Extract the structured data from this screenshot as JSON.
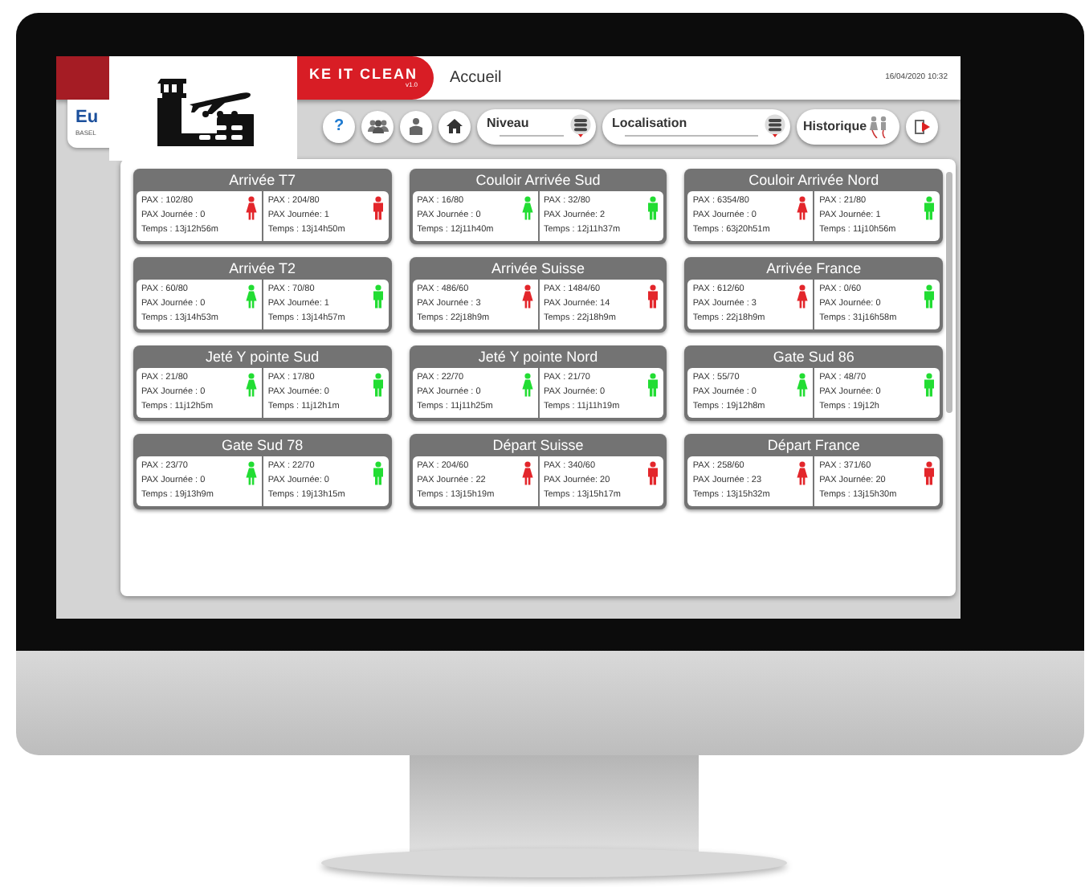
{
  "header": {
    "brand_text": "KE IT CLEAN",
    "version": "v1.0",
    "title": "Accueil",
    "datetime": "16/04/2020 10:32",
    "org_text": "Eu",
    "org_subtext": "BASEL"
  },
  "toolbar": {
    "dropdowns": [
      {
        "label": "Niveau"
      },
      {
        "label": "Localisation"
      }
    ],
    "history_label": "Historique",
    "help_label": "?"
  },
  "zones": [
    {
      "name": "Arrivée T7",
      "slots": [
        {
          "kind": "women",
          "color": "#e3262b",
          "pax": "PAX : 102/80",
          "pax_day": "PAX Journée : 0",
          "time": "Temps : 13j12h56m"
        },
        {
          "kind": "men",
          "color": "#e3262b",
          "pax": "PAX : 204/80",
          "pax_day": "PAX Journée: 1",
          "time": "Temps : 13j14h50m"
        }
      ]
    },
    {
      "name": "Couloir Arrivée Sud",
      "slots": [
        {
          "kind": "women",
          "color": "#22dd33",
          "pax": "PAX : 16/80",
          "pax_day": "PAX Journée : 0",
          "time": "Temps : 12j11h40m"
        },
        {
          "kind": "men",
          "color": "#22dd33",
          "pax": "PAX : 32/80",
          "pax_day": "PAX Journée: 2",
          "time": "Temps : 12j11h37m"
        }
      ]
    },
    {
      "name": "Couloir Arrivée Nord",
      "slots": [
        {
          "kind": "women",
          "color": "#e3262b",
          "pax": "PAX : 6354/80",
          "pax_day": "PAX Journée : 0",
          "time": "Temps : 63j20h51m"
        },
        {
          "kind": "men",
          "color": "#22dd33",
          "pax": "PAX : 21/80",
          "pax_day": "PAX Journée: 1",
          "time": "Temps : 11j10h56m"
        }
      ]
    },
    {
      "name": "Arrivée T2",
      "slots": [
        {
          "kind": "women",
          "color": "#22dd33",
          "pax": "PAX : 60/80",
          "pax_day": "PAX Journée : 0",
          "time": "Temps : 13j14h53m"
        },
        {
          "kind": "men",
          "color": "#22dd33",
          "pax": "PAX : 70/80",
          "pax_day": "PAX Journée: 1",
          "time": "Temps : 13j14h57m"
        }
      ]
    },
    {
      "name": "Arrivée Suisse",
      "slots": [
        {
          "kind": "women",
          "color": "#e3262b",
          "pax": "PAX : 486/60",
          "pax_day": "PAX Journée : 3",
          "time": "Temps : 22j18h9m"
        },
        {
          "kind": "men",
          "color": "#e3262b",
          "pax": "PAX : 1484/60",
          "pax_day": "PAX Journée: 14",
          "time": "Temps : 22j18h9m"
        }
      ]
    },
    {
      "name": "Arrivée France",
      "slots": [
        {
          "kind": "women",
          "color": "#e3262b",
          "pax": "PAX : 612/60",
          "pax_day": "PAX Journée : 3",
          "time": "Temps : 22j18h9m"
        },
        {
          "kind": "men",
          "color": "#22dd33",
          "pax": "PAX : 0/60",
          "pax_day": "PAX Journée: 0",
          "time": "Temps : 31j16h58m"
        }
      ]
    },
    {
      "name": "Jeté Y pointe Sud",
      "slots": [
        {
          "kind": "women",
          "color": "#22dd33",
          "pax": "PAX : 21/80",
          "pax_day": "PAX Journée : 0",
          "time": "Temps : 11j12h5m"
        },
        {
          "kind": "men",
          "color": "#22dd33",
          "pax": "PAX : 17/80",
          "pax_day": "PAX Journée: 0",
          "time": "Temps : 11j12h1m"
        }
      ]
    },
    {
      "name": "Jeté Y pointe Nord",
      "slots": [
        {
          "kind": "women",
          "color": "#22dd33",
          "pax": "PAX : 22/70",
          "pax_day": "PAX Journée : 0",
          "time": "Temps : 11j11h25m"
        },
        {
          "kind": "men",
          "color": "#22dd33",
          "pax": "PAX : 21/70",
          "pax_day": "PAX Journée: 0",
          "time": "Temps : 11j11h19m"
        }
      ]
    },
    {
      "name": "Gate Sud 86",
      "slots": [
        {
          "kind": "women",
          "color": "#22dd33",
          "pax": "PAX : 55/70",
          "pax_day": "PAX Journée : 0",
          "time": "Temps : 19j12h8m"
        },
        {
          "kind": "men",
          "color": "#22dd33",
          "pax": "PAX : 48/70",
          "pax_day": "PAX Journée: 0",
          "time": "Temps : 19j12h"
        }
      ]
    },
    {
      "name": "Gate Sud 78",
      "slots": [
        {
          "kind": "women",
          "color": "#22dd33",
          "pax": "PAX : 23/70",
          "pax_day": "PAX Journée : 0",
          "time": "Temps : 19j13h9m"
        },
        {
          "kind": "men",
          "color": "#22dd33",
          "pax": "PAX : 22/70",
          "pax_day": "PAX Journée: 0",
          "time": "Temps : 19j13h15m"
        }
      ]
    },
    {
      "name": "Départ Suisse",
      "slots": [
        {
          "kind": "women",
          "color": "#e3262b",
          "pax": "PAX : 204/60",
          "pax_day": "PAX Journée : 22",
          "time": "Temps : 13j15h19m"
        },
        {
          "kind": "men",
          "color": "#e3262b",
          "pax": "PAX : 340/60",
          "pax_day": "PAX Journée: 20",
          "time": "Temps : 13j15h17m"
        }
      ]
    },
    {
      "name": "Départ France",
      "slots": [
        {
          "kind": "women",
          "color": "#e3262b",
          "pax": "PAX : 258/60",
          "pax_day": "PAX Journée : 23",
          "time": "Temps : 13j15h32m"
        },
        {
          "kind": "men",
          "color": "#e3262b",
          "pax": "PAX : 371/60",
          "pax_day": "PAX Journée: 20",
          "time": "Temps : 13j15h30m"
        }
      ]
    }
  ]
}
